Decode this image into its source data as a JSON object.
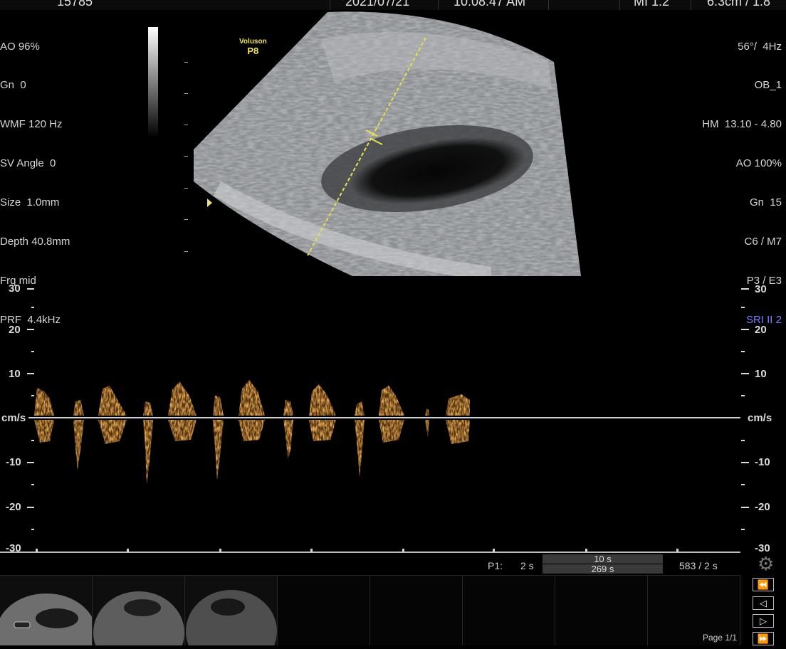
{
  "top_bar": {
    "patient_id": "15785",
    "date": "2021/07/21",
    "time": "10:08:47 AM",
    "mi": "MI  1.2",
    "depth_freq": "6.3cm / 1.8"
  },
  "left_params": [
    "AO 96%",
    "Gn  0",
    "WMF 120 Hz",
    "SV Angle  0",
    "Size  1.0mm",
    "Depth 40.8mm",
    "Frq mid",
    "PRF  4.4kHz"
  ],
  "right_params": [
    "56°/  4Hz",
    "OB_1",
    "HM  13.10 - 4.80",
    "AO 100%",
    "Gn  15",
    "C6 / M7",
    "P3 / E3"
  ],
  "right_sri": "SRI II 2",
  "probe": {
    "brand": "Voluson",
    "model": "P8"
  },
  "velocity_scale": {
    "unit": "cm/s",
    "left_ticks": [
      "30",
      "20",
      "10",
      "-10",
      "-20",
      "-30"
    ],
    "right_ticks": [
      "30",
      "20",
      "10",
      "-10",
      "-20",
      "-30"
    ]
  },
  "playback": {
    "p1_label": "P1:",
    "p1_value": "2 s",
    "duration_top": "10 s",
    "duration_bottom": "269 s",
    "frames": "583 / 2 s"
  },
  "thumbnails_page": "Page 1/1",
  "nav_buttons": [
    "⏪",
    "◁",
    "▷",
    "⏩"
  ],
  "colors": {
    "doppler": "#e08a2c",
    "caliper": "#e8e04a",
    "sri": "#7b7bff"
  },
  "icons": {
    "settings": "gear-icon"
  }
}
